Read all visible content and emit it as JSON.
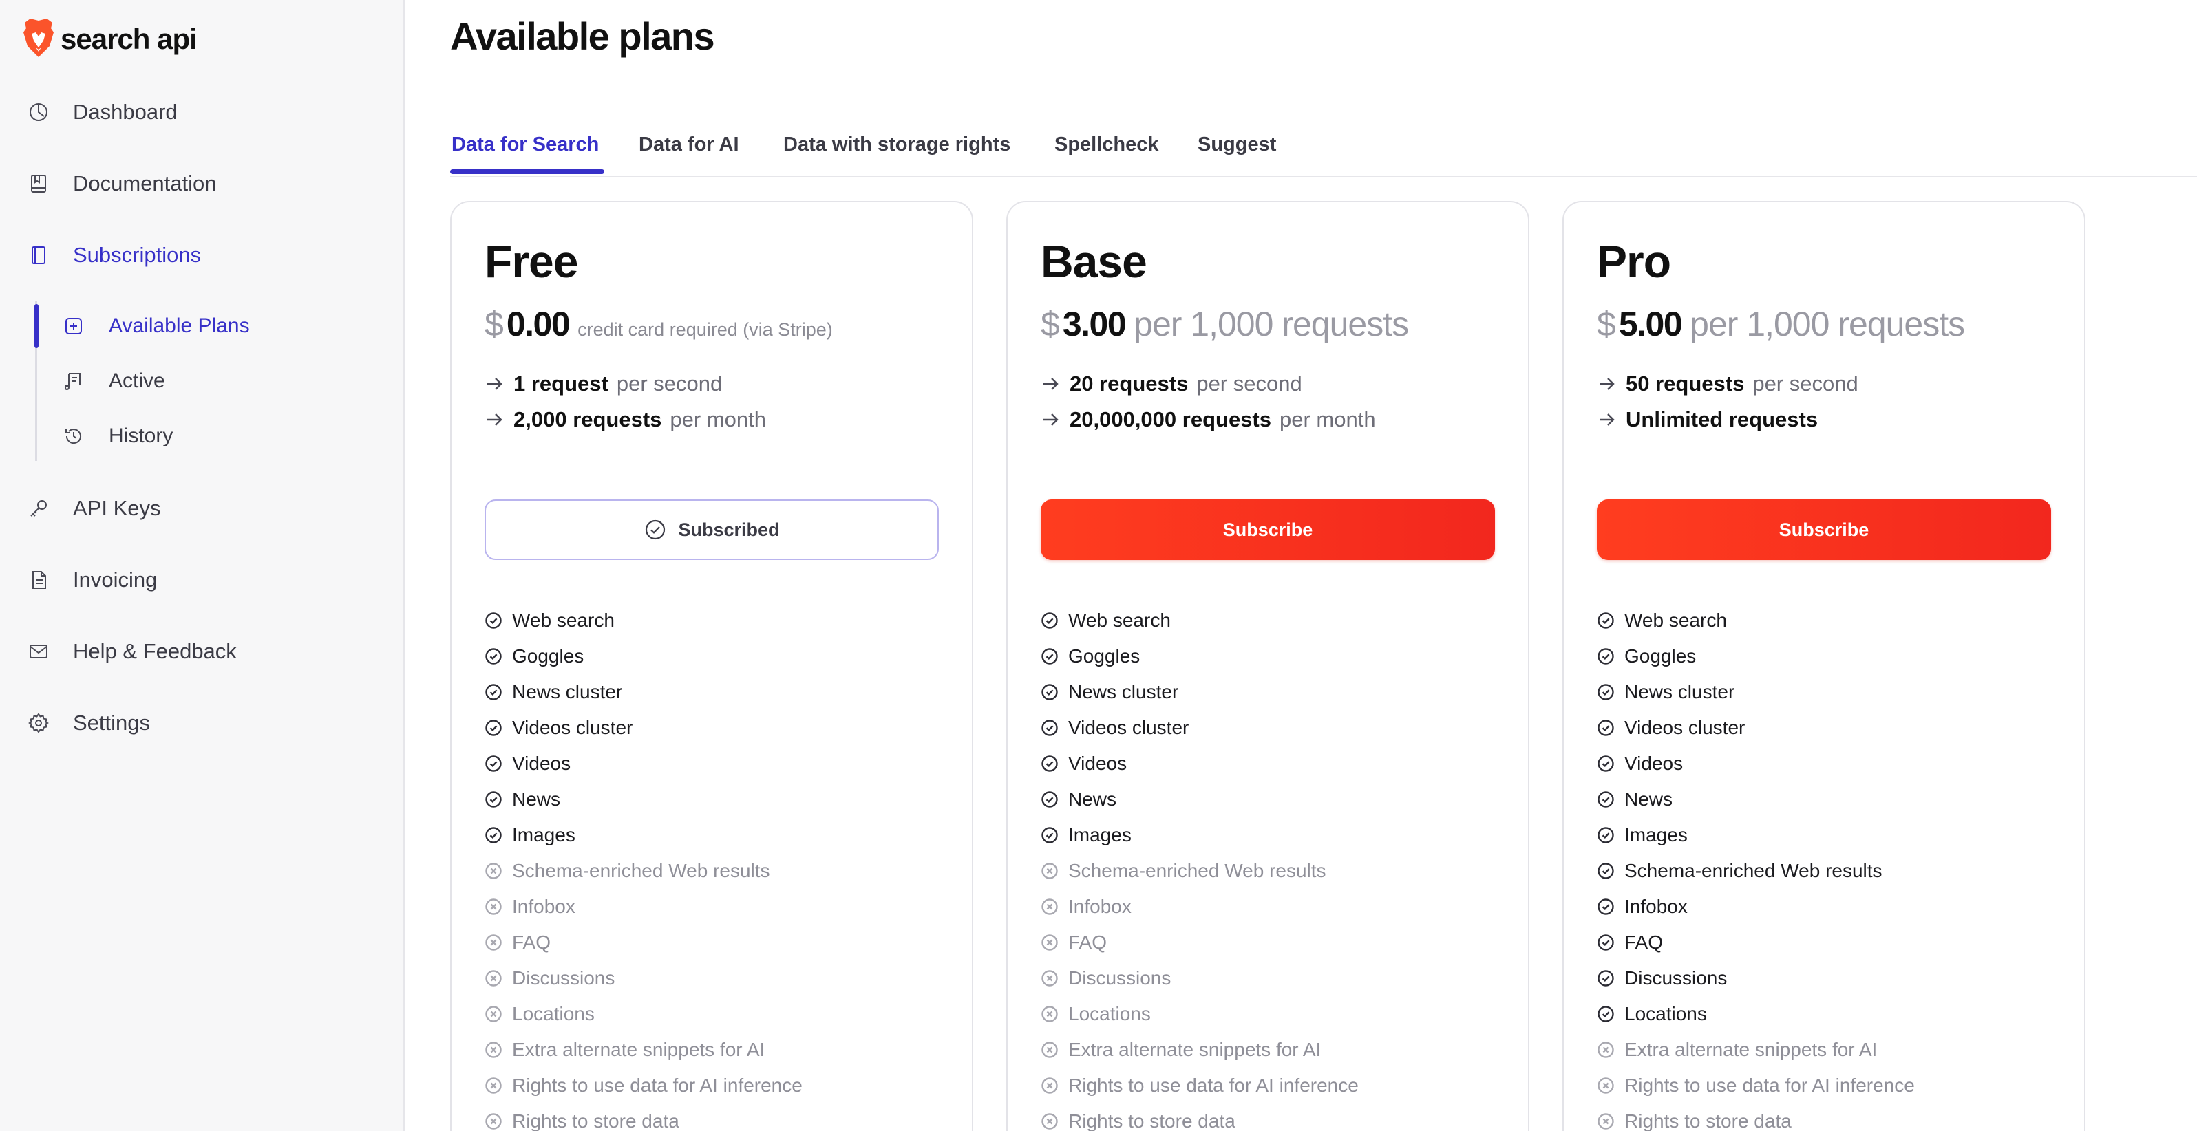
{
  "app": {
    "logo_text": "search api"
  },
  "sidebar": {
    "items": [
      {
        "key": "dashboard",
        "label": "Dashboard",
        "icon": "dashboard-icon"
      },
      {
        "key": "documentation",
        "label": "Documentation",
        "icon": "book-icon"
      },
      {
        "key": "subscriptions",
        "label": "Subscriptions",
        "icon": "subscriptions-icon"
      },
      {
        "key": "api-keys",
        "label": "API Keys",
        "icon": "key-icon"
      },
      {
        "key": "invoicing",
        "label": "Invoicing",
        "icon": "document-icon"
      },
      {
        "key": "help",
        "label": "Help & Feedback",
        "icon": "mail-icon"
      },
      {
        "key": "settings",
        "label": "Settings",
        "icon": "gear-icon"
      }
    ],
    "subitems": [
      {
        "key": "available-plans",
        "label": "Available Plans",
        "icon": "plus-square-icon"
      },
      {
        "key": "active",
        "label": "Active",
        "icon": "receipt-icon"
      },
      {
        "key": "history",
        "label": "History",
        "icon": "history-icon"
      }
    ]
  },
  "main": {
    "title": "Available plans",
    "tabs": [
      {
        "label": "Data for Search",
        "active": true
      },
      {
        "label": "Data for AI",
        "active": false
      },
      {
        "label": "Data with storage rights",
        "active": false
      },
      {
        "label": "Spellcheck",
        "active": false
      },
      {
        "label": "Suggest",
        "active": false
      }
    ],
    "plans": [
      {
        "name": "Free",
        "currency": "$",
        "price": "0.00",
        "price_unit": "credit card required (via Stripe)",
        "limit1_strong": "1 request",
        "limit1_weak": "per second",
        "limit2_strong": "2,000 requests",
        "limit2_weak": "per month",
        "button_label": "Subscribed",
        "subscribed": true,
        "features": [
          {
            "label": "Web search",
            "included": true
          },
          {
            "label": "Goggles",
            "included": true
          },
          {
            "label": "News cluster",
            "included": true
          },
          {
            "label": "Videos cluster",
            "included": true
          },
          {
            "label": "Videos",
            "included": true
          },
          {
            "label": "News",
            "included": true
          },
          {
            "label": "Images",
            "included": true
          },
          {
            "label": "Schema-enriched Web results",
            "included": false
          },
          {
            "label": "Infobox",
            "included": false
          },
          {
            "label": "FAQ",
            "included": false
          },
          {
            "label": "Discussions",
            "included": false
          },
          {
            "label": "Locations",
            "included": false
          },
          {
            "label": "Extra alternate snippets for AI",
            "included": false
          },
          {
            "label": "Rights to use data for AI inference",
            "included": false
          },
          {
            "label": "Rights to store data",
            "included": false
          }
        ]
      },
      {
        "name": "Base",
        "currency": "$",
        "price": "3.00",
        "price_unit": "per 1,000 requests",
        "limit1_strong": "20 requests",
        "limit1_weak": "per second",
        "limit2_strong": "20,000,000 requests",
        "limit2_weak": "per month",
        "button_label": "Subscribe",
        "subscribed": false,
        "features": [
          {
            "label": "Web search",
            "included": true
          },
          {
            "label": "Goggles",
            "included": true
          },
          {
            "label": "News cluster",
            "included": true
          },
          {
            "label": "Videos cluster",
            "included": true
          },
          {
            "label": "Videos",
            "included": true
          },
          {
            "label": "News",
            "included": true
          },
          {
            "label": "Images",
            "included": true
          },
          {
            "label": "Schema-enriched Web results",
            "included": false
          },
          {
            "label": "Infobox",
            "included": false
          },
          {
            "label": "FAQ",
            "included": false
          },
          {
            "label": "Discussions",
            "included": false
          },
          {
            "label": "Locations",
            "included": false
          },
          {
            "label": "Extra alternate snippets for AI",
            "included": false
          },
          {
            "label": "Rights to use data for AI inference",
            "included": false
          },
          {
            "label": "Rights to store data",
            "included": false
          }
        ]
      },
      {
        "name": "Pro",
        "currency": "$",
        "price": "5.00",
        "price_unit": "per 1,000 requests",
        "limit1_strong": "50 requests",
        "limit1_weak": "per second",
        "limit2_strong": "Unlimited requests",
        "limit2_weak": "",
        "button_label": "Subscribe",
        "subscribed": false,
        "features": [
          {
            "label": "Web search",
            "included": true
          },
          {
            "label": "Goggles",
            "included": true
          },
          {
            "label": "News cluster",
            "included": true
          },
          {
            "label": "Videos cluster",
            "included": true
          },
          {
            "label": "Videos",
            "included": true
          },
          {
            "label": "News",
            "included": true
          },
          {
            "label": "Images",
            "included": true
          },
          {
            "label": "Schema-enriched Web results",
            "included": true
          },
          {
            "label": "Infobox",
            "included": true
          },
          {
            "label": "FAQ",
            "included": true
          },
          {
            "label": "Discussions",
            "included": true
          },
          {
            "label": "Locations",
            "included": true
          },
          {
            "label": "Extra alternate snippets for AI",
            "included": false
          },
          {
            "label": "Rights to use data for AI inference",
            "included": false
          },
          {
            "label": "Rights to store data",
            "included": false
          }
        ]
      }
    ]
  },
  "colors": {
    "accent": "#3730c8",
    "brand": "#f2271e",
    "sidebar_bg": "#f7f7f8"
  }
}
